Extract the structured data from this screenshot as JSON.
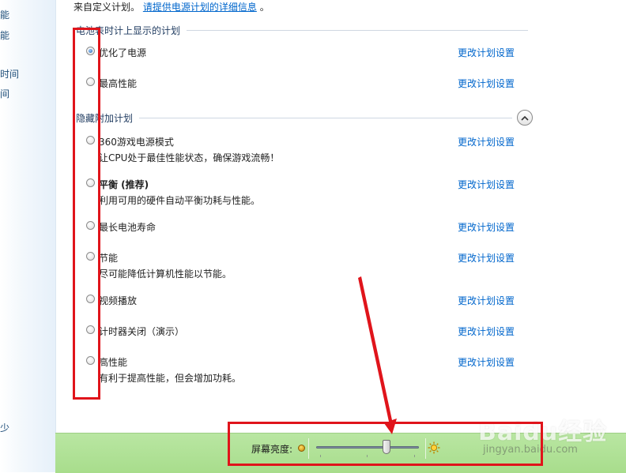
{
  "sidebar": {
    "fragments": [
      "能",
      "能",
      "时间",
      "间",
      "少"
    ]
  },
  "intro": {
    "text": "来自定义计划。",
    "link": "请提供电源计划的详细信息"
  },
  "groups": {
    "shown_label": "电池表时计上显示的计划",
    "hidden_label": "隐藏附加计划"
  },
  "plans": [
    {
      "name": "优化了电源",
      "desc": "",
      "bold": false,
      "selected": true,
      "link": "更改计划设置"
    },
    {
      "name": "最高性能",
      "desc": "",
      "bold": false,
      "selected": false,
      "link": "更改计划设置"
    },
    {
      "name": "360游戏电源模式",
      "desc": "让CPU处于最佳性能状态，确保游戏流畅！",
      "bold": false,
      "selected": false,
      "link": "更改计划设置"
    },
    {
      "name": "平衡 (推荐)",
      "desc": "利用可用的硬件自动平衡功耗与性能。",
      "bold": true,
      "selected": false,
      "link": "更改计划设置"
    },
    {
      "name": "最长电池寿命",
      "desc": "",
      "bold": false,
      "selected": false,
      "link": "更改计划设置"
    },
    {
      "name": "节能",
      "desc": "尽可能降低计算机性能以节能。",
      "bold": false,
      "selected": false,
      "link": "更改计划设置"
    },
    {
      "name": "视频播放",
      "desc": "",
      "bold": false,
      "selected": false,
      "link": "更改计划设置"
    },
    {
      "name": "计时器关闭（演示）",
      "desc": "",
      "bold": false,
      "selected": false,
      "link": "更改计划设置"
    },
    {
      "name": "高性能",
      "desc": "有利于提高性能，但会增加功耗。",
      "bold": false,
      "selected": false,
      "link": "更改计划设置"
    }
  ],
  "brightness": {
    "label": "屏幕亮度:",
    "value_fraction": 0.7
  },
  "watermark": {
    "logo": "Baidu经验",
    "url": "jingyan.baidu.com"
  },
  "colors": {
    "annotation": "#e0141b",
    "link": "#0066cc",
    "bottom_bar": "#b0e196"
  }
}
